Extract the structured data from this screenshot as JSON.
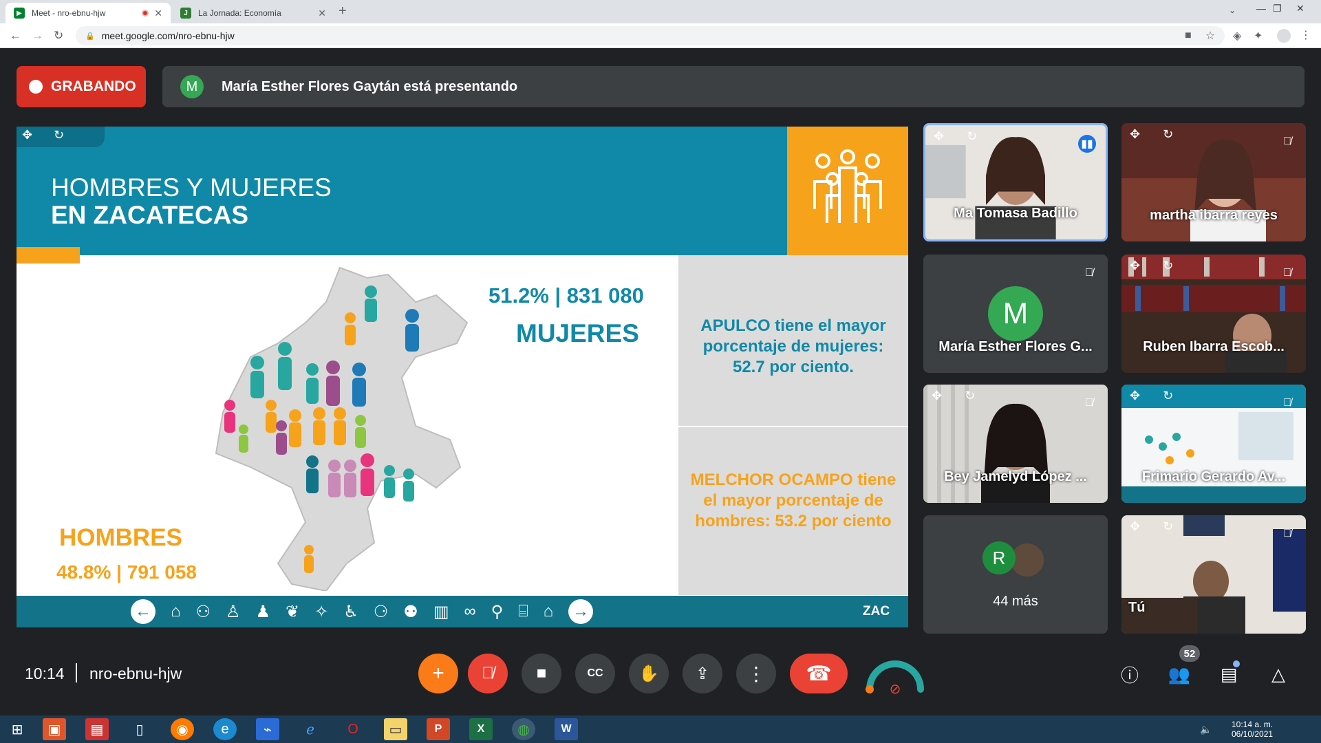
{
  "browser": {
    "tabs": [
      {
        "title": "Meet - nro-ebnu-hjw",
        "active": true
      },
      {
        "title": "La Jornada: Economía",
        "active": false
      }
    ],
    "url": "meet.google.com/nro-ebnu-hjw"
  },
  "meet": {
    "recording_label": "GRABANDO",
    "presenter_initial": "M",
    "presenting_text": "María Esther Flores Gaytán está presentando",
    "meeting_time": "10:14",
    "meeting_code": "nro-ebnu-hjw",
    "participants_count": "52",
    "more_label": "44 más",
    "more_initial": "R"
  },
  "slide": {
    "title_line1": "HOMBRES Y MUJERES",
    "title_line2": "EN ZACATECAS",
    "mujeres_pct": "51.2% | 831 080",
    "mujeres_label": "MUJERES",
    "hombres_label": "HOMBRES",
    "hombres_pct": "48.8% | 791 058",
    "panel1_text": "APULCO tiene el mayor porcentaje de mujeres: 52.7 por ciento.",
    "panel2_text": "MELCHOR OCAMPO tiene el mayor porcentaje de hombres: 53.2 por ciento",
    "footer_code": "ZAC"
  },
  "tiles": [
    {
      "name": "Ma Tomasa Badillo",
      "speaking": true
    },
    {
      "name": "martha ibarra reyes",
      "speaking": false
    },
    {
      "name": "María Esther Flores G...",
      "initial": "M",
      "speaking": false
    },
    {
      "name": "Ruben Ibarra Escob...",
      "speaking": false
    },
    {
      "name": "Bey Jamelyd López ...",
      "speaking": false
    },
    {
      "name": "Frimario Gerardo Av...",
      "speaking": false
    },
    {
      "name": "Tú",
      "speaking": false
    }
  ],
  "taskbar": {
    "time": "10:14 a. m.",
    "date": "06/10/2021"
  },
  "colors": {
    "slide_teal": "#1089a8",
    "slide_orange": "#f7a21b",
    "record_red": "#d93025",
    "end_call_red": "#ea4335"
  }
}
